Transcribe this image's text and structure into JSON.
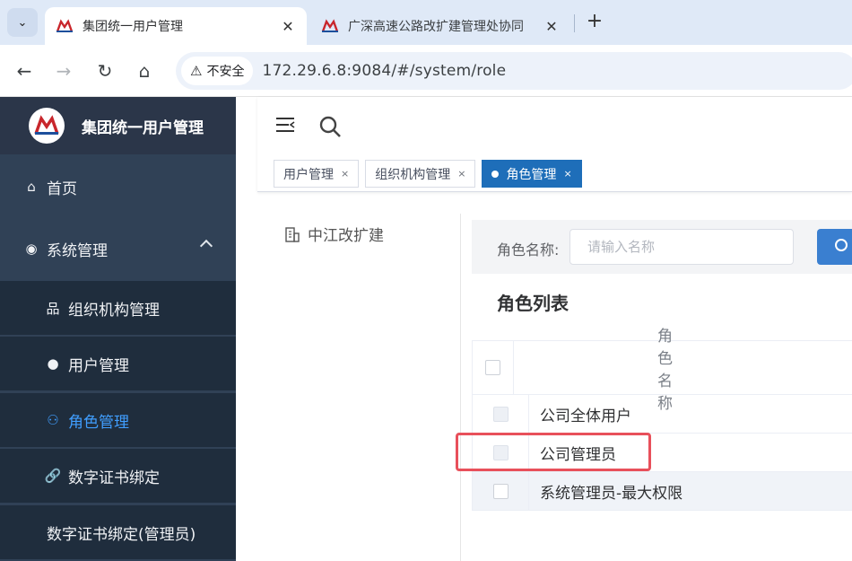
{
  "browser": {
    "tabs": [
      {
        "title": "集团统一用户管理",
        "active": true
      },
      {
        "title": "广深高速公路改扩建管理处协同",
        "active": false
      }
    ],
    "close_glyph": "✕",
    "new_tab_glyph": "+",
    "security_text": "不安全",
    "url": "172.29.6.8:9084/#/system/role"
  },
  "sidebar": {
    "brand_title": "集团统一用户管理",
    "items": [
      {
        "label": "首页",
        "icon": "home-icon",
        "glyph": "⌂"
      },
      {
        "label": "系统管理",
        "icon": "settings-circle-icon",
        "glyph": "◉"
      },
      {
        "label": "组织机构管理",
        "icon": "org-tree-icon",
        "glyph": "品"
      },
      {
        "label": "用户管理",
        "icon": "user-icon",
        "glyph": "●"
      },
      {
        "label": "角色管理",
        "icon": "role-icon",
        "glyph": "⚇"
      },
      {
        "label": "数字证书绑定",
        "icon": "link-icon",
        "glyph": "🔗"
      },
      {
        "label": "数字证书绑定(管理员)",
        "icon": "",
        "glyph": ""
      }
    ],
    "active_color": "#409eff"
  },
  "tags": [
    {
      "label": "用户管理",
      "close": "×"
    },
    {
      "label": "组织机构管理",
      "close": "×"
    },
    {
      "label": "角色管理",
      "close": "×",
      "active": true
    }
  ],
  "tree": {
    "root": "中江改扩建"
  },
  "search": {
    "label": "角色名称:",
    "placeholder": "请输入名称"
  },
  "list": {
    "title": "角色列表",
    "header": "角色名称",
    "rows": [
      "公司全体用户",
      "公司管理员",
      "系统管理员-最大权限"
    ]
  },
  "colors": {
    "sidebar_bg": "#304156",
    "primary": "#1e6eb9",
    "highlight": "#e8505b"
  }
}
